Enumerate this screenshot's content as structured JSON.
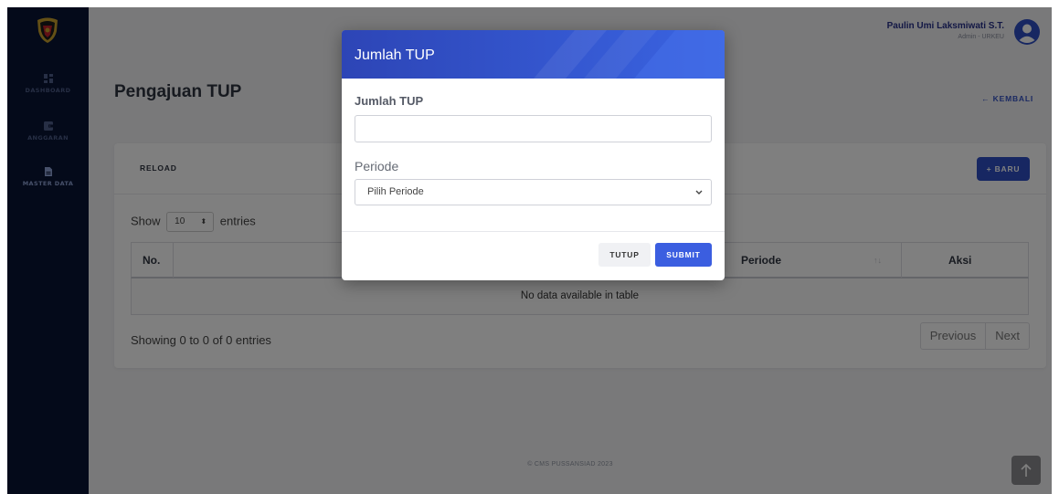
{
  "sidebar": {
    "logo_icon": "police-shield-logo",
    "items": [
      {
        "label": "DASHBOARD",
        "icon": "dashboard-icon",
        "active": false
      },
      {
        "label": "ANGGARAN",
        "icon": "wallet-icon",
        "active": false
      },
      {
        "label": "MASTER DATA",
        "icon": "document-icon",
        "active": true
      }
    ]
  },
  "header": {
    "user_name": "Paulin Umi Laksmiwati S.T.",
    "user_role": "Admin - URKEU",
    "avatar_icon": "user-circle-icon"
  },
  "page": {
    "title": "Pengajuan TUP",
    "back_label": "← KEMBALI"
  },
  "card": {
    "reload_label": "RELOAD",
    "new_label": "+ BARU",
    "show_prefix": "Show",
    "page_length": "10",
    "show_suffix": "entries",
    "columns": [
      "No.",
      "Periode",
      "Aksi"
    ],
    "empty_text": "No data available in table",
    "info_text": "Showing 0 to 0 of 0 entries",
    "prev_label": "Previous",
    "next_label": "Next"
  },
  "footer": {
    "text": "© CMS PUSSANSIAD 2023",
    "scroll_icon": "arrow-up-icon"
  },
  "modal": {
    "title": "Jumlah TUP",
    "amount_label": "Jumlah TUP",
    "amount_value": "",
    "period_label": "Periode",
    "period_selected": "Pilih Periode",
    "close_label": "TUTUP",
    "submit_label": "SUBMIT"
  },
  "colors": {
    "sidebar_bg": "#081434",
    "primary": "#2f4fc4",
    "submit": "#3b5ee0",
    "modal_header": "#2f4cc0"
  }
}
